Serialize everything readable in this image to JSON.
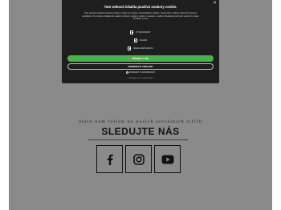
{
  "cookie_modal": {
    "title": "Tato webová lokalita používá soubory cookie.",
    "description": "Tato webová lokalita používá soubory cookie ke zlepšení uživatelského zážitku. Používáním našich webových stránek souhlasíte, že budeme vkládat do vašeho zařízení soubory cookie v souladu s našimi zásadami používání souborů cookie. Přečtěte si více",
    "close_symbol": "×",
    "options": [
      {
        "label": "Výkonnost"
      },
      {
        "label": "Cílení"
      },
      {
        "label": "Nehlasovanou"
      }
    ],
    "accept_label": "Přijmout vše",
    "reject_label": "Odmítnout všechny",
    "details_label": "Zobrazit podrobnosti",
    "powered_by": "Powered by CookieScript"
  },
  "social": {
    "subtitle": "dejte nám follow na našich sociálních sítích",
    "title": "SLEDUJTE NÁS",
    "links": [
      {
        "icon": "facebook-icon"
      },
      {
        "icon": "instagram-icon"
      },
      {
        "icon": "youtube-icon"
      }
    ]
  },
  "colors": {
    "overlay": "#8a8a8a",
    "modal_bg": "#1e1e1e",
    "accept": "#4caf50"
  }
}
